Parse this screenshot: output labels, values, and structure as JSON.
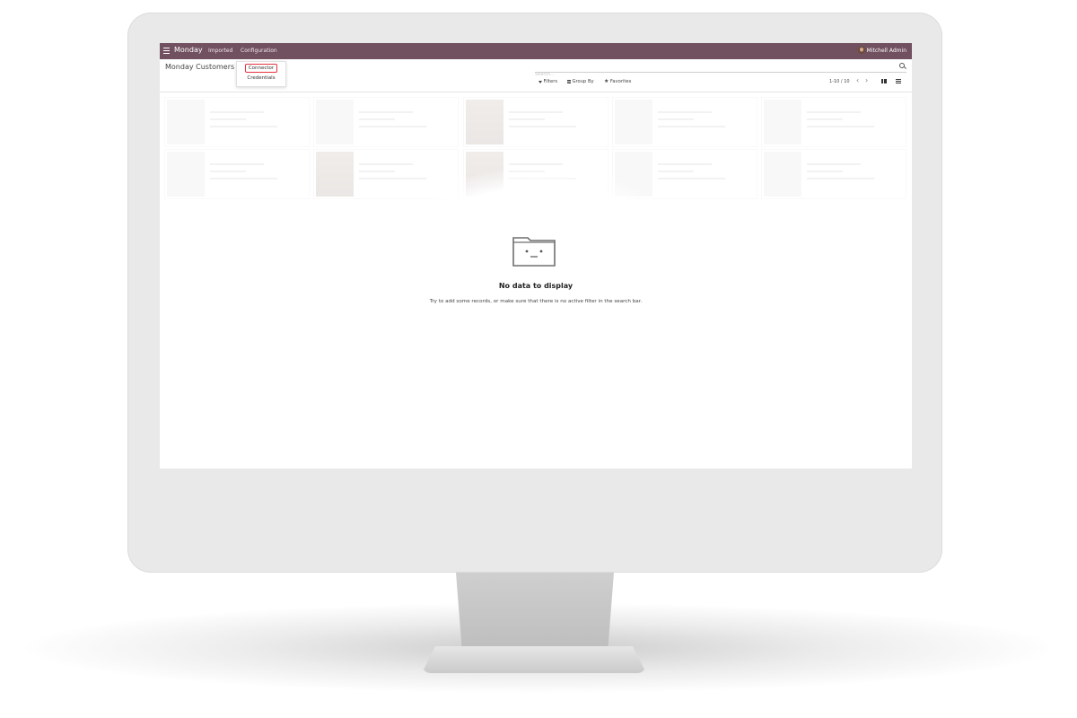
{
  "app": {
    "name": "Monday",
    "nav": [
      "Imported",
      "Configuration"
    ],
    "user": "Mitchell Admin"
  },
  "control": {
    "page_title": "Monday Customers",
    "search_placeholder": "Search...",
    "filters_label": "Filters",
    "groupby_label": "Group By",
    "favorites_label": "Favorites",
    "pager": "1-10 / 10"
  },
  "dropdown": {
    "items": [
      "Connector",
      "Credentials"
    ]
  },
  "empty_state": {
    "title": "No data to display",
    "text": "Try to add some records, or make sure that there is no active filter in the search bar."
  },
  "colors": {
    "topbar": "#71505f",
    "highlight": "#e4333f"
  }
}
